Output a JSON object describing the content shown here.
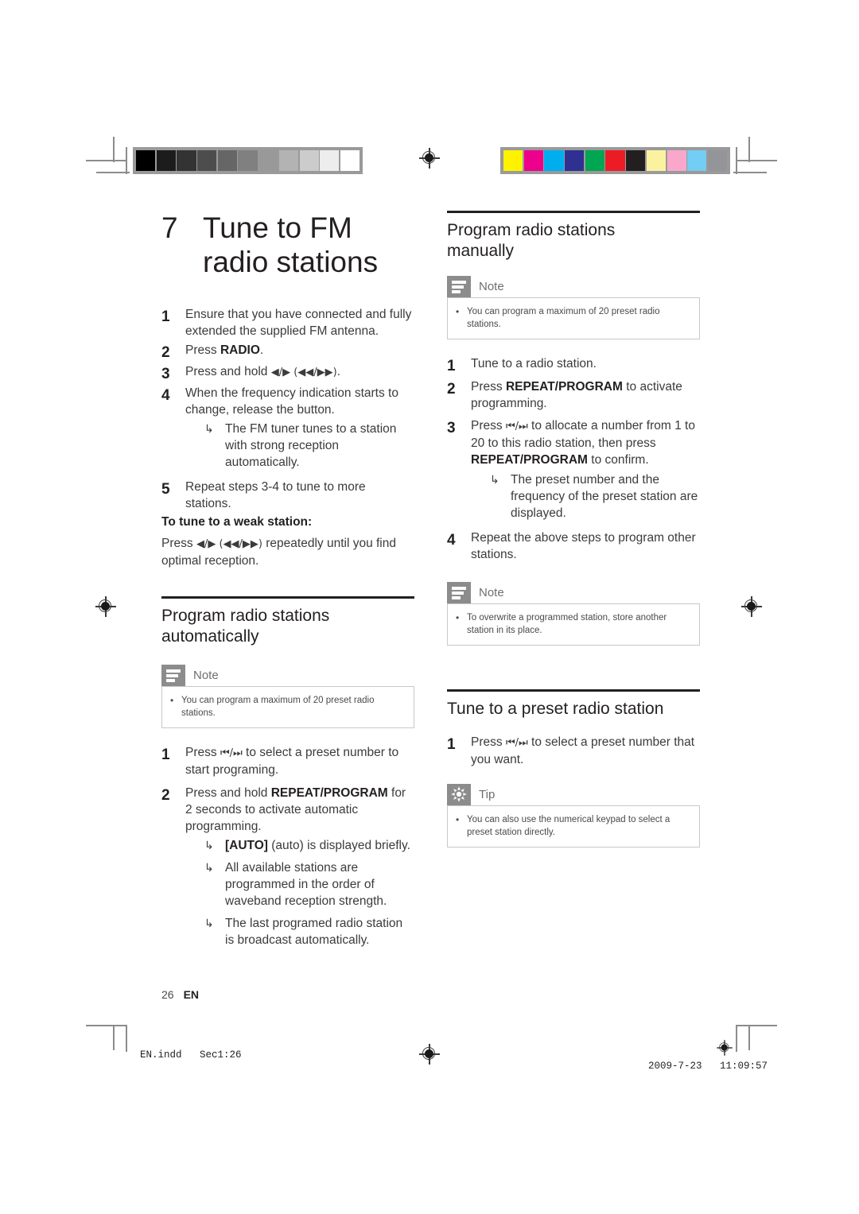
{
  "document": {
    "page_number": "26",
    "language_code": "EN",
    "print_footer_left": "EN.indd   Sec1:26",
    "print_footer_date": "2009-7-23",
    "print_footer_time": "11:09:57"
  },
  "calibration": {
    "grayscale_swatches": [
      "#000000",
      "#1c1c1c",
      "#333333",
      "#4d4d4d",
      "#666666",
      "#808080",
      "#999999",
      "#b3b3b3",
      "#cccccc",
      "#ededed",
      "#ffffff"
    ],
    "color_swatches": [
      "#fff200",
      "#ec008c",
      "#00aeef",
      "#2e3192",
      "#00a651",
      "#ed1c24",
      "#231f20",
      "#fbf2a0",
      "#f9a8cb",
      "#74cdf2",
      "#939598"
    ]
  },
  "chapter": {
    "number": "7",
    "title_line1": "Tune to FM",
    "title_line2": "radio stations"
  },
  "tune_fm": {
    "steps": [
      {
        "num": "1",
        "text": "Ensure that you have connected and fully extended the supplied FM antenna."
      },
      {
        "num": "2",
        "text_prefix": "Press ",
        "bold": "RADIO",
        "text_suffix": "."
      },
      {
        "num": "3",
        "text_prefix": "Press and hold ",
        "glyph": "◀/▶ (◀◀/▶▶)",
        "text_suffix": "."
      },
      {
        "num": "4",
        "text": "When the frequency indication starts to change, release the button."
      },
      {
        "num": "5",
        "text": "Repeat steps 3-4 to tune to more stations."
      }
    ],
    "step4_result": "The FM tuner tunes to a station with strong reception automatically.",
    "weak_station_heading": "To tune to a weak station:",
    "weak_station_prefix": "Press ",
    "weak_station_glyph": "◀/▶ (◀◀/▶▶)",
    "weak_station_suffix": " repeatedly until you find optimal reception."
  },
  "program_auto": {
    "heading_line1": "Program radio stations",
    "heading_line2": "automatically",
    "note": {
      "label": "Note",
      "icon": "note-icon",
      "bullet": "•",
      "text": "You can program a maximum of 20 preset radio stations."
    },
    "steps": [
      {
        "num": "1",
        "text_prefix": "Press ",
        "glyph": "⏮/⏭",
        "text_suffix": " to select a preset number to start programing."
      },
      {
        "num": "2",
        "text_prefix": "Press and hold ",
        "bold": "REPEAT/PROGRAM",
        "text_suffix": " for 2 seconds to activate automatic programming."
      }
    ],
    "step2_results": [
      {
        "bold": "[AUTO]",
        "text": " (auto) is displayed briefly."
      },
      {
        "bold": "",
        "text": "All available stations are programmed in the order of waveband reception strength."
      },
      {
        "bold": "",
        "text": "The last programed radio station is broadcast automatically."
      }
    ]
  },
  "program_manual": {
    "heading_line1": "Program radio stations",
    "heading_line2": "manually",
    "note_top": {
      "label": "Note",
      "icon": "note-icon",
      "bullet": "•",
      "text": "You can program a maximum of 20 preset radio stations."
    },
    "steps": [
      {
        "num": "1",
        "text": "Tune to a radio station."
      },
      {
        "num": "2",
        "text_prefix": "Press ",
        "bold": "REPEAT/PROGRAM",
        "text_suffix": " to activate programming."
      },
      {
        "num": "3",
        "text_prefix": "Press ",
        "glyph": "⏮/⏭",
        "text_mid": " to allocate a number from 1 to 20 to this radio station, then press ",
        "bold": "REPEAT/PROGRAM",
        "text_suffix": " to confirm."
      },
      {
        "num": "4",
        "text": "Repeat the above steps to program other stations."
      }
    ],
    "step3_result": "The preset number and the frequency of the preset station are displayed.",
    "note_bottom": {
      "label": "Note",
      "icon": "note-icon",
      "bullet": "•",
      "text": "To overwrite a programmed station, store another station in its place."
    }
  },
  "tune_preset": {
    "heading": "Tune to a preset radio station",
    "steps": [
      {
        "num": "1",
        "text_prefix": "Press ",
        "glyph": "⏮/⏭",
        "text_suffix": " to select a preset number that you want."
      }
    ],
    "tip": {
      "label": "Tip",
      "icon": "tip-icon",
      "bullet": "•",
      "text": "You can also use the numerical keypad to select a preset station directly."
    }
  },
  "symbols": {
    "result_arrow": "↳"
  }
}
